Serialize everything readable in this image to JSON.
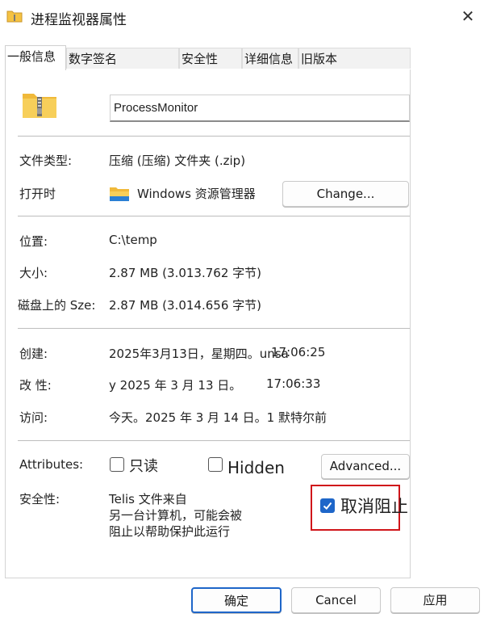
{
  "window": {
    "title": "进程监视器属性",
    "close_glyph": "✕"
  },
  "tabs": [
    {
      "label": "一般信息"
    },
    {
      "label": "数字签名"
    },
    {
      "label": "安全性"
    },
    {
      "label": "详细信息"
    },
    {
      "label": "旧版本"
    }
  ],
  "general": {
    "file_name": "ProcessMonitor",
    "file_type_label": "文件类型:",
    "file_type_value": "压缩 (压缩) 文件夹 (.zip)",
    "opens_with_label": "打开时",
    "opens_with_value": "Windows 资源管理器",
    "change_button": "Change...",
    "location_label": "位置:",
    "location_value": "C:\\temp",
    "size_label": "大小:",
    "size_value": "2.87 MB  (3.013.762 字节)",
    "size_on_disk_label": "磁盘上的 Sze:",
    "size_on_disk_value": "2.87 MB (3.014.656 字节)",
    "created_label": "创建:",
    "created_value": "2025年3月13日，星期四。unsa",
    "created_time": "17:06:25",
    "modified_label": "改 性:",
    "modified_value": "y 2025 年 3 月 13 日。",
    "modified_time": "17:06:33",
    "accessed_label": "访问:",
    "accessed_value": "今天。2025 年 3 月 14 日。1 默特尔前",
    "attributes_label": "Attributes:",
    "readonly_label": "只读",
    "hidden_label": "Hidden",
    "advanced_button": "Advanced...",
    "security_label": "安全性:",
    "security_text_1": "Telis 文件来自",
    "security_text_2": "另一台计算机，可能会被",
    "security_text_3": "阻止以帮助保护此运行",
    "unblock_label": "取消阻止"
  },
  "footer": {
    "ok_button": "确定",
    "cancel_button": "Cancel",
    "apply_button": "应用"
  },
  "colors": {
    "accent": "#1e66c9",
    "highlight_box": "#d0151a",
    "folder_yellow": "#f5c242"
  },
  "icons": {
    "title": "folder-zip-icon",
    "big": "zip-folder-icon",
    "opens_with": "file-explorer-icon",
    "close": "close-icon",
    "check": "checkmark-icon"
  }
}
